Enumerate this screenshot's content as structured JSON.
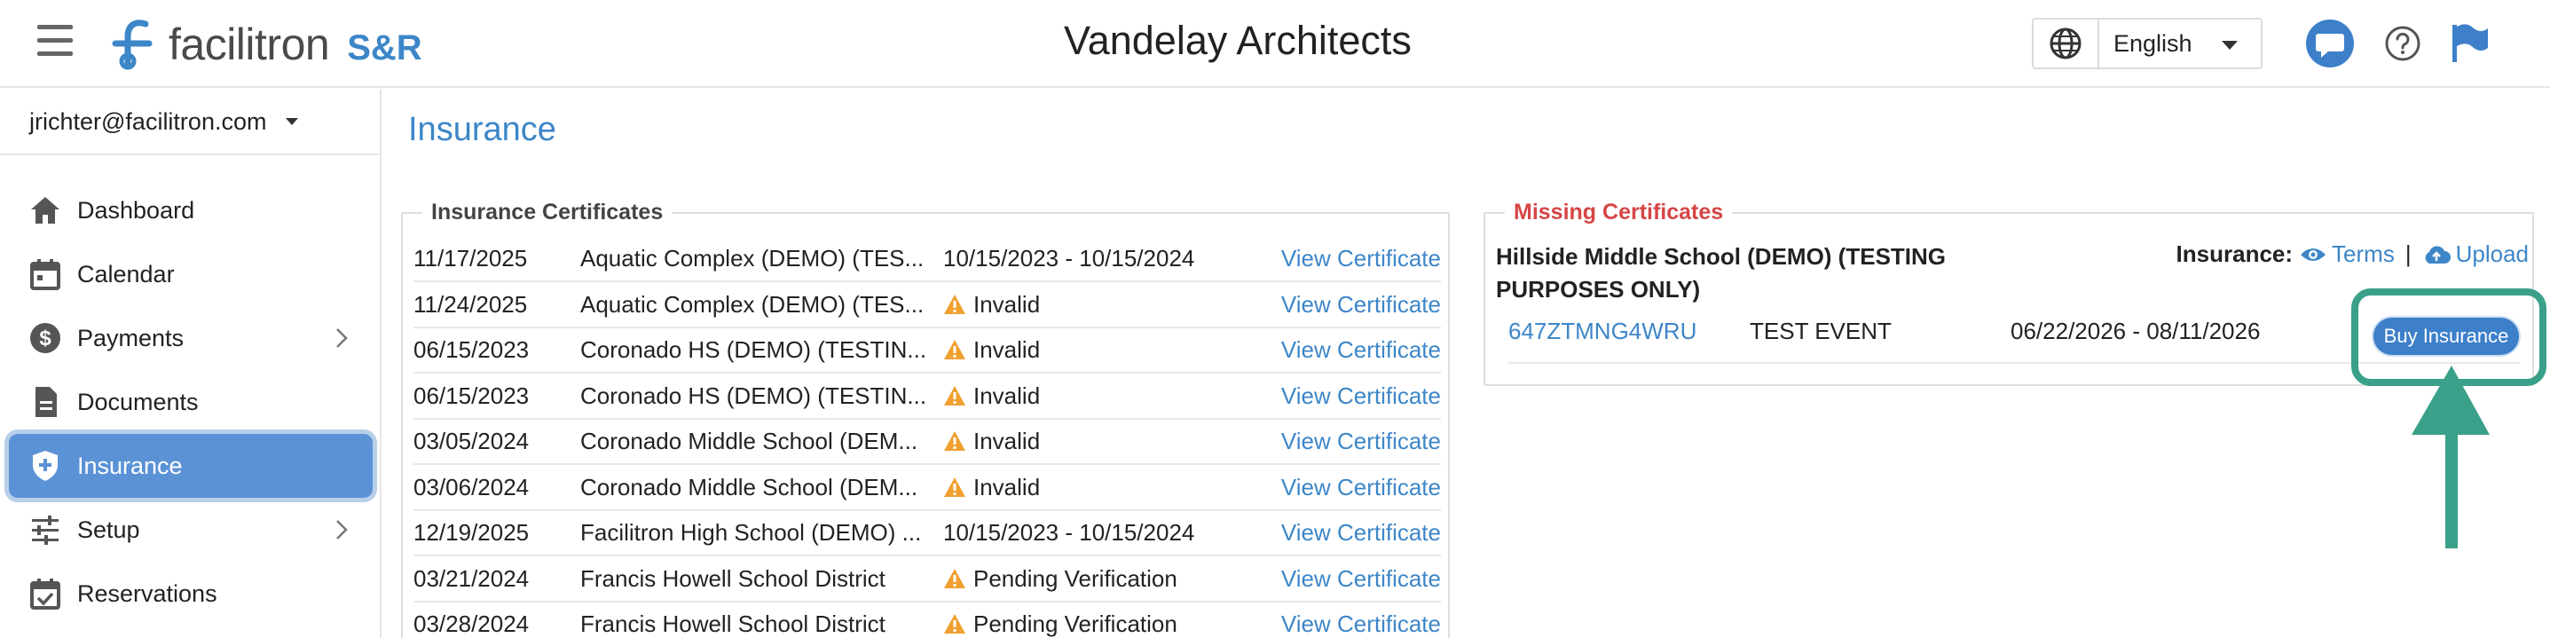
{
  "header": {
    "logo_text": "facilitron",
    "logo_tag": "S&R",
    "title": "Vandelay Architects",
    "language": "English",
    "icons": [
      "menu-icon",
      "globe-icon",
      "chat-icon",
      "help-icon",
      "flag-icon"
    ]
  },
  "sidebar": {
    "user_email": "jrichter@facilitron.com",
    "items": [
      {
        "label": "Dashboard",
        "icon": "home-icon",
        "has_submenu": false
      },
      {
        "label": "Calendar",
        "icon": "calendar-icon",
        "has_submenu": false
      },
      {
        "label": "Payments",
        "icon": "dollar-icon",
        "has_submenu": true
      },
      {
        "label": "Documents",
        "icon": "document-icon",
        "has_submenu": false
      },
      {
        "label": "Insurance",
        "icon": "shield-icon",
        "has_submenu": false,
        "active": true
      },
      {
        "label": "Setup",
        "icon": "sliders-icon",
        "has_submenu": true
      },
      {
        "label": "Reservations",
        "icon": "calendar-check-icon",
        "has_submenu": false
      }
    ]
  },
  "main": {
    "page_title": "Insurance",
    "certificates": {
      "legend": "Insurance Certificates",
      "rows": [
        {
          "date": "11/17/2025",
          "facility": "Aquatic Complex (DEMO) (TES...",
          "status": "10/15/2023 - 10/15/2024",
          "warning": false,
          "link": "View Certificate"
        },
        {
          "date": "11/24/2025",
          "facility": "Aquatic Complex (DEMO) (TES...",
          "status": "Invalid",
          "warning": true,
          "link": "View Certificate"
        },
        {
          "date": "06/15/2023",
          "facility": "Coronado HS (DEMO) (TESTIN...",
          "status": "Invalid",
          "warning": true,
          "link": "View Certificate"
        },
        {
          "date": "06/15/2023",
          "facility": "Coronado HS (DEMO) (TESTIN...",
          "status": "Invalid",
          "warning": true,
          "link": "View Certificate"
        },
        {
          "date": "03/05/2024",
          "facility": "Coronado Middle School (DEM...",
          "status": "Invalid",
          "warning": true,
          "link": "View Certificate"
        },
        {
          "date": "03/06/2024",
          "facility": "Coronado Middle School (DEM...",
          "status": "Invalid",
          "warning": true,
          "link": "View Certificate"
        },
        {
          "date": "12/19/2025",
          "facility": "Facilitron High School (DEMO) ...",
          "status": "10/15/2023 - 10/15/2024",
          "warning": false,
          "link": "View Certificate"
        },
        {
          "date": "03/21/2024",
          "facility": "Francis Howell School District",
          "status": "Pending Verification",
          "warning": true,
          "link": "View Certificate"
        },
        {
          "date": "03/28/2024",
          "facility": "Francis Howell School District",
          "status": "Pending Verification",
          "warning": true,
          "link": "View Certificate"
        }
      ]
    },
    "missing": {
      "legend": "Missing Certificates",
      "school_line1": "Hillside Middle School (DEMO) (TESTING",
      "school_line2": "PURPOSES ONLY)",
      "insurance_label": "Insurance:",
      "terms_label": "Terms",
      "separator": "|",
      "upload_label": "Upload",
      "reservation_id": "647ZTMNG4WRU",
      "event_name": "TEST EVENT",
      "dates": "06/22/2026 - 08/11/2026",
      "buy_label": "Buy Insurance"
    }
  },
  "colors": {
    "brand_blue": "#3d86c8",
    "active_nav": "#5b92d6",
    "missing_red": "#d64545",
    "highlight_green": "#3aa08a",
    "warning_orange": "#f0a030"
  }
}
